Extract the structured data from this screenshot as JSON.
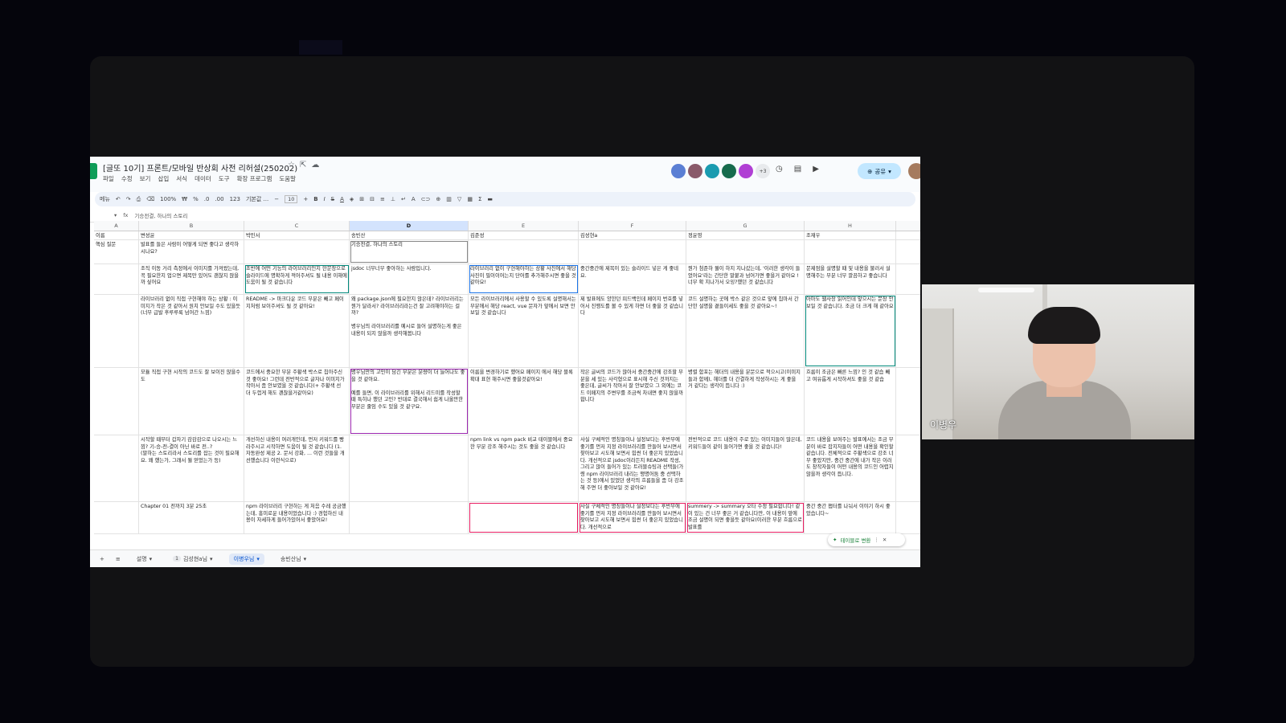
{
  "sheets": {
    "title": "[글또 10기] 프론트/모바일 반상회 사전 리허설(250202)",
    "menus": [
      "파일",
      "수정",
      "보기",
      "삽입",
      "서식",
      "데이터",
      "도구",
      "확장 프로그램",
      "도움말"
    ],
    "avatar_extra": "+3",
    "share_label": "공유",
    "toolbar": {
      "search": "메뉴",
      "zoom": "100%",
      "currency": "₩",
      "percent": "%",
      "decrease_decimal": ".0",
      "increase_decimal": ".00",
      "number_format": "123",
      "font": "기본값 ...",
      "font_size": "10"
    },
    "formula": {
      "cell_ref": "",
      "fx": "fx",
      "content": "기승전결, 하나의 스토리"
    },
    "columns": [
      "A",
      "B",
      "C",
      "D",
      "E",
      "F",
      "G",
      "H"
    ],
    "selected_column": "D",
    "header_row": [
      "이름",
      "변성윤",
      "박민서",
      "송빈산",
      "김준성",
      "김성현a",
      "정윤영",
      "조재우"
    ],
    "rows": [
      [
        "핵심 질문",
        "발표를 들은 사람이 어떻게 되면 좋다고 생각하시나요?",
        "",
        "기승전결, 하나의 스토리",
        "",
        "",
        "",
        ""
      ],
      [
        "",
        "조직 이동 거리 측정에서 이미지를 가져왔는데, 꼭 필요한지 업으면 제목만 있어도 괜찮지 않을까 싶어요",
        "초반에 어떤 기능의 라이브러리인지 한문장으로 슬라이드에 명확하게 적어주셔도 될 내용 이해에 도움이 될 것 같습니다",
        "jsdoc 너무너무 좋아하는 사람입니다.",
        "라이브러리 없이 구현해야하는 상황 사진에서 해당 사진이 필이이어는지 단어를 추가해주시면 좋을 것 같아요!",
        "중간중간에 제목이 있는 슬라이드 넣은 게 좋네요.",
        "뭔가 첨준하 뭘이 하지 지나갔는데, '이러한 생각이 들었어요'라는 간단한 말붙과 넘어가면 좋을거 같아요 ! 너무 확 지나가서 오잉?했던 것 같습니다",
        "문제점을 설명할 때 및 내용을 불러서 설명해주는 부분 너무 깔끔하고 좋습니다"
      ],
      [
        "",
        "라이브러리 없이 직접 구현해야 하는 상황 : 이미지가 작은 것 같아서 원치 안보일 수도 있을듯(너무 급발 후루루룩 넘어간 느낌)",
        "README -> 마크다운 코드 부분은 빼고 페이지처럼 보이주셔도 될 것 같아요!",
        "왜 package.json에 필요한지 않은데? 라이브러리는 뭔가 달라서? 라이브러리라는건 잘 고려해야하는 걸까?\n\n병우님의 라이브러리를 예시로 들어 설명하는게 좋은 내용이 되지 않을까 생각해봅니다",
        "모든 라이브러리에서 사용할 수 있도록 설명해서는 부분에서 해당 react, vue 문자가 앞에서 보면 안보일 것 같습니다",
        "제 발표에도 양한던 피드백인데 페이지 번호를 넣어서 진행도를 볼 수 있게 하면 더 좋을 것 같습니다",
        "코드 설명하는 곳에 박스 같은 것으로 앞에 칩마서 간단한 설명을 곁들이세도 좋을 것 같아요~!",
        "아마도 웹사장 읽어인데 앞으시는 문장 안보일 것 같습니다. 조금 더 크게 해 같아요"
      ],
      [
        "",
        "모듈 직접 구현 시작의 코드도 잘 보이진 않을수도",
        "코드에서 중요한 부분 주황색 박스로 칩아주신 것 좋아요! 그런데 전반적으로 글자나 이미지가 작아서 좀 안보였을 것 같습니다(+ 주황색 선 더 두껍게 해도 괜찮을거같아요)",
        "병우님만의 고민이 담긴 부분은 분량이 더 늘어나도 좋을 것 같아요.\n\n예를 들면, 이 라이브러리를 위해서 리드미를 작성할 때 특히나 했던 고민? 반대로 결국해서 쉽게 나올만한 부분은 줄임 수도 있을 것 같구요.",
        "이름을 변경하기로 했어요 페이지 에서 해당 블록 확대 표현 해주시면 좋을것같아요!",
        "작은 글씨의 코드가 많아서 중간중간에 강조할 부분을 세 있는 사각형으로 표시해 주신 것까지는 좋은데, 글씨가 작아서 잘 안보였으 그 외에는 코드 이페지의 주변부를 조금씩 차내면 좋지 않을까 합니다",
        "병렬 함포는 헤더의 내용을 분문으로 적으시고(이미지들과 함께), 헤더를 더 간결하게 작성하시는 게 좋을 거 같다는 생각이 듭니다 :)",
        "흐름이 조금은 빠른 느낌? 인 것 같습 빼고 여유롭게 시작하셔도 좋을 것 같습"
      ],
      [
        "",
        "시작할 때부터 갑자기 감감감으로 나오시는 느낌? 기-승-전-결이 아닌 바로 전..?\n(말하는 스토리라서 스토리를 잡는 것이 필요해요. 왜 했는가, 그래서 뭘 얻었는가 등)",
        "개선하신 내용이 여러개인데, 먼저 키워드를 빵라주시고 시작하면 도움이 될 것 같습니다 (1. 자동완성 제공 2. 문서 강화, ... 이런 것들을 개선했습니다 이런식으로)",
        "",
        "npm link vs npm pack 비교 테이블에서 중요한 부분 강조 해주시는 것도 좋을 것 같습니다",
        "사실 구체적인 명칭들이나 설정보다는 후반부에 좋기를 먼저 지정 라이브러리를 만들어 보시면서 찾아보고 시도해 보면서 힘썬 더 좋은지 있었습니다. 개선적으로 jsdoc이라든지 README 작성, 그리고 많이 들어가 있는 트러블슈팅과 선택들(가령 npm 라이브러리 내리는 맹명어둠 중 선택하는 것 등)에서 있었던 생각의 흐름들을 좀 더 강조해 주면 더 좋아보일 것 같아요!",
        "전반적으로 코드 내용이 주로 있는 이미지들이 많은데, 키워드들이 같이 들어가면 좋을 것 같습니다!",
        "코드 내용을 보여주는 발표에서는 조금 부분이 바로 잡지자들이 어떤 내용을 확인할 같습니다. 전체적으로 주황색으로 강조 너무 좋았지만, 중간 중간에 내가 작은 이러도 창작자들이 어떤 내용의 코드인 어렵지 않을까 생각이 듭니다."
      ],
      [
        "",
        "Chapter 01 전까지 3분 25초",
        "npm 라이브러리 구현하는 게 처음 수레 공금했는데, 흥미로운 내용이었습니다 :) 경험하신 내용이 자세하게 들어가있어서 좋았어요!",
        "",
        "",
        "사실 구체적인 명칭들이나 설정보다는 후반부에 좋기를 먼저 지정 라이브러리를 만들어 보시면서 찾아보고 시도해 보면서 힘썬 더 좋은지 있었습니다. 개선적으로",
        "summery -> summary 오타 수정 필요합니다! 같이 있는 건 너무 좋은 거 같습니다만, 이 내용이 앞에 조금 설명이 되면 좋을듯 같아요(이러한 부분 흐름으로 발표를",
        "중간 중간 챕터를 나눠서 이야기 하시 좋았습니다~"
      ]
    ],
    "sheet_tabs": [
      {
        "label": "설명",
        "num": ""
      },
      {
        "label": "김성현a님",
        "num": "1"
      },
      {
        "label": "이병우님",
        "num": ""
      },
      {
        "label": "송빈산님",
        "num": ""
      }
    ],
    "convert_label": "테이블로 변환"
  },
  "video": {
    "participant_name": "이병우"
  }
}
